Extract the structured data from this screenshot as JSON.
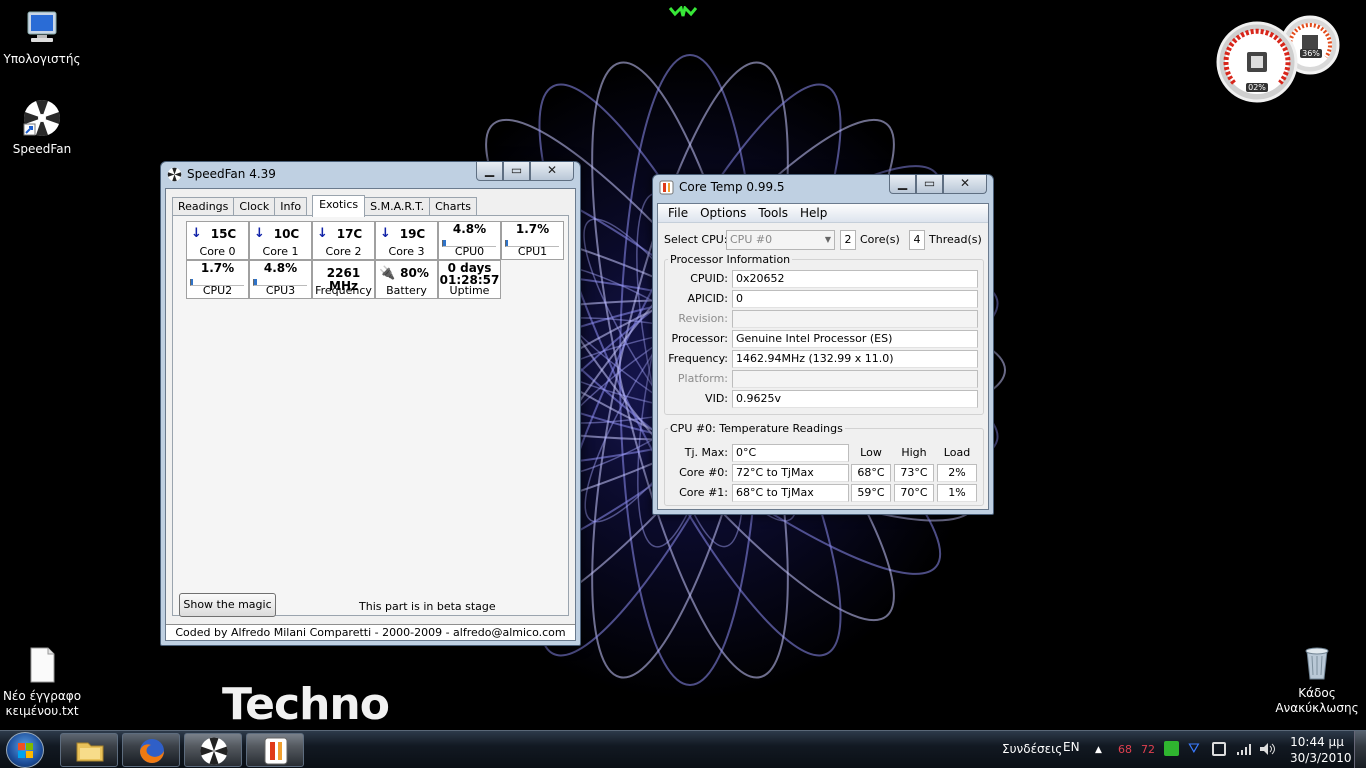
{
  "desktop": {
    "icons": [
      {
        "label": "Υπολογιστής",
        "icon": "computer-icon"
      },
      {
        "label": "SpeedFan",
        "icon": "speedfan-shortcut-icon"
      },
      {
        "label": "Νέο έγγραφο κειμένου.txt",
        "icon": "text-file-icon"
      },
      {
        "label": "Κάδος Ανακύκλωσης",
        "icon": "recycle-bin-icon"
      }
    ],
    "watermark": "Techno",
    "gauges": {
      "cpu_percent": "02%",
      "memory_percent": "36%"
    }
  },
  "speedfan": {
    "title": "SpeedFan 4.39",
    "tabs": [
      "Readings",
      "Clock",
      "Info",
      "Exotics",
      "S.M.A.R.T.",
      "Charts"
    ],
    "active_tab": "Exotics",
    "cells": [
      {
        "value": "15C",
        "label": "Core 0",
        "kind": "temp"
      },
      {
        "value": "10C",
        "label": "Core 1",
        "kind": "temp"
      },
      {
        "value": "17C",
        "label": "Core 2",
        "kind": "temp"
      },
      {
        "value": "19C",
        "label": "Core 3",
        "kind": "temp"
      },
      {
        "value": "4.8%",
        "label": "CPU0",
        "kind": "usage",
        "level": 0.048
      },
      {
        "value": "1.7%",
        "label": "CPU1",
        "kind": "usage",
        "level": 0.017
      },
      {
        "value": "1.7%",
        "label": "CPU2",
        "kind": "usage",
        "level": 0.017
      },
      {
        "value": "4.8%",
        "label": "CPU3",
        "kind": "usage",
        "level": 0.048
      },
      {
        "value": "2261 MHz",
        "label": "Frequency",
        "kind": "plain"
      },
      {
        "value": "80%",
        "label": "Battery",
        "kind": "battery"
      },
      {
        "value": "0 days",
        "value2": "01:28:57",
        "label": "Uptime",
        "kind": "uptime"
      }
    ],
    "show_magic_button": "Show the magic",
    "beta_note": "This part is in beta stage",
    "footer": "Coded by Alfredo Milani Comparetti - 2000-2009 - alfredo@almico.com"
  },
  "coretemp": {
    "title": "Core Temp 0.99.5",
    "menu": [
      "File",
      "Options",
      "Tools",
      "Help"
    ],
    "select_cpu_label": "Select CPU:",
    "select_cpu_value": "CPU #0",
    "cores_count": "2",
    "cores_label": "Core(s)",
    "threads_count": "4",
    "threads_label": "Thread(s)",
    "processor_info_title": "Processor Information",
    "info": [
      {
        "label": "CPUID:",
        "value": "0x20652",
        "disabled": false
      },
      {
        "label": "APICID:",
        "value": "0",
        "disabled": false
      },
      {
        "label": "Revision:",
        "value": "",
        "disabled": true
      },
      {
        "label": "Processor:",
        "value": "Genuine Intel Processor (ES)",
        "disabled": false
      },
      {
        "label": "Frequency:",
        "value": "1462.94MHz (132.99 x 11.0)",
        "disabled": false
      },
      {
        "label": "Platform:",
        "value": "",
        "disabled": true
      },
      {
        "label": "VID:",
        "value": "0.9625v",
        "disabled": false
      }
    ],
    "temp_title": "CPU #0: Temperature Readings",
    "tjmax_label": "Tj. Max:",
    "tjmax_value": "0°C",
    "col_low": "Low",
    "col_high": "High",
    "col_load": "Load",
    "cores": [
      {
        "label": "Core #0:",
        "value": "72°C to TjMax",
        "low": "68°C",
        "high": "73°C",
        "load": "2%"
      },
      {
        "label": "Core #1:",
        "value": "68°C to TjMax",
        "low": "59°C",
        "high": "70°C",
        "load": "1%"
      }
    ]
  },
  "taskbar": {
    "language": "EN",
    "connections": "Συνδέσεις",
    "tray_temp1": "68",
    "tray_temp2": "72",
    "time": "10:44 μμ",
    "date": "30/3/2010"
  }
}
